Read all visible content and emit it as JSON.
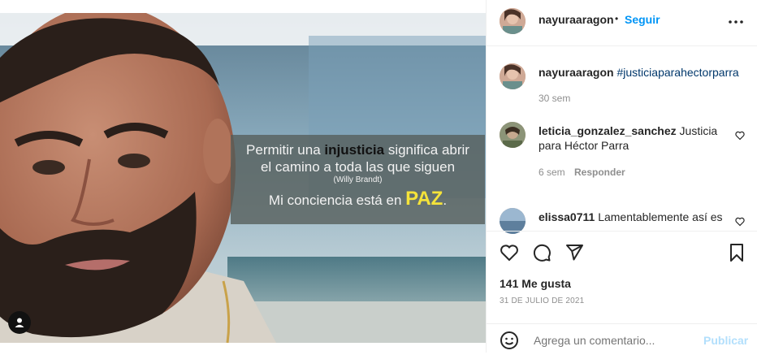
{
  "post": {
    "quote_line1_before": "Permitir una ",
    "quote_line1_highlight": "injusticia",
    "quote_line1_after": " significa abrir",
    "quote_line2": "el camino a toda las que siguen",
    "quote_author": "(Willy Brandt)",
    "quote_line4_before": "Mi conciencia está en ",
    "quote_line4_emphasis": "PAZ",
    "quote_line4_after": ".",
    "tagged_user_icon": "user-silhouette-icon"
  },
  "header": {
    "username": "nayuraaragon",
    "separator": "•",
    "follow_label": "Seguir",
    "more_icon": "more-options-icon"
  },
  "caption": {
    "username": "nayuraaragon",
    "hashtag": "#justiciaparahectorparra",
    "time": "30 sem"
  },
  "comments": [
    {
      "username": "leticia_gonzalez_sanchez",
      "text_line1": "Justicia",
      "text_line2": "para Héctor Parra",
      "time": "6 sem",
      "reply_label": "Responder"
    },
    {
      "username": "elissa0711",
      "text_line1": "Lamentablemente así es"
    }
  ],
  "actions": {
    "icons": [
      "like-heart-icon",
      "comment-icon",
      "share-icon",
      "save-bookmark-icon"
    ],
    "likes": "141 Me gusta",
    "date": "31 DE JULIO DE 2021"
  },
  "comment_box": {
    "placeholder": "Agrega un comentario...",
    "publish_label": "Publicar",
    "emoji_icon": "emoji-icon"
  },
  "colors": {
    "accent": "#0095f6",
    "publish_disabled": "#b2dffc",
    "paz_yellow": "#f5e33a",
    "hashtag": "#00376b"
  }
}
